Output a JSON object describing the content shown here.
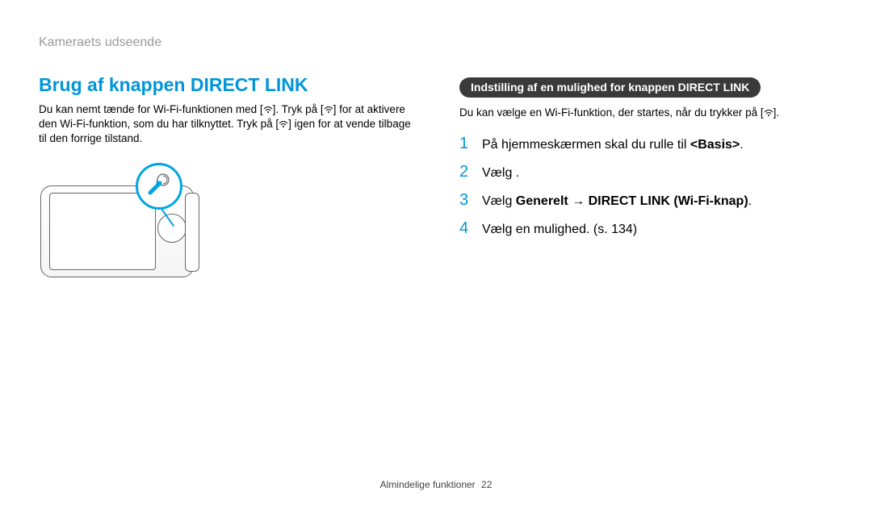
{
  "breadcrumb": "Kameraets udseende",
  "heading": "Brug af knappen DIRECT LINK",
  "left": {
    "p1a": "Du kan nemt tænde for Wi-Fi-funktionen med [",
    "p1b": "]. Tryk på [",
    "p1c": "] for at aktivere den Wi-Fi-funktion, som du har tilknyttet. Tryk på [",
    "p1d": "] igen for at vende tilbage til den forrige tilstand."
  },
  "right": {
    "pill": "Indstilling af en mulighed for knappen DIRECT LINK",
    "p1a": "Du kan vælge en Wi-Fi-funktion, der startes, når du trykker på [",
    "p1b": "].",
    "steps": [
      {
        "num": "1",
        "pre": "På hjemmeskærmen skal du rulle til ",
        "bold": "<Basis>",
        "post": "."
      },
      {
        "num": "2",
        "pre": "Vælg ",
        "bold": "",
        "post": " ."
      },
      {
        "num": "3",
        "pre": "Vælg ",
        "bold": "Generelt → DIRECT LINK (Wi-Fi-knap)",
        "post": "."
      },
      {
        "num": "4",
        "pre": "Vælg en mulighed. (s. 134)",
        "bold": "",
        "post": ""
      }
    ]
  },
  "footer": {
    "label": "Almindelige funktioner",
    "page": "22"
  }
}
